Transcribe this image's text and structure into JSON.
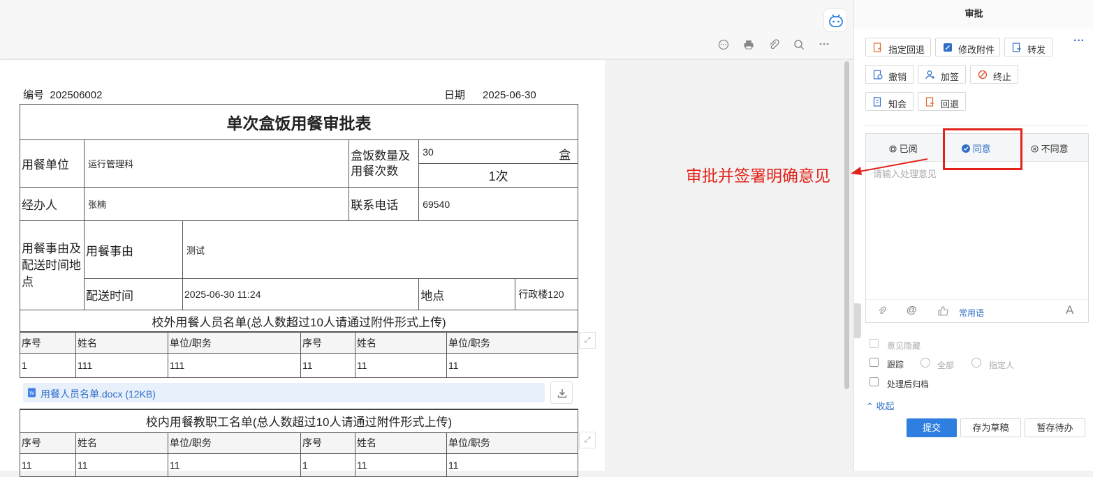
{
  "toolbar": {
    "icons": [
      "comment-icon",
      "print-icon",
      "attachment-icon",
      "search-icon",
      "more-icon"
    ],
    "assistant_icon": "robot-icon"
  },
  "form": {
    "serial_label": "编号",
    "serial_value": "202506002",
    "date_label": "日期",
    "date_value": "2025-06-30",
    "title": "单次盒饭用餐审批表",
    "unit_label": "用餐单位",
    "unit_value": "运行管理科",
    "qty_label": "盒饭数量及用餐次数",
    "qty_value": "30",
    "qty_unit": "盒",
    "times_value": "1次",
    "handler_label": "经办人",
    "handler_value": "张楠",
    "phone_label": "联系电话",
    "phone_value": "69540",
    "reason_group_label": "用餐事由及配送时间地点",
    "reason_label": "用餐事由",
    "reason_value": "测试",
    "delivery_time_label": "配送时间",
    "delivery_time_value": "2025-06-30 11:24",
    "place_label": "地点",
    "place_value": "行政楼120"
  },
  "external_list": {
    "title": "校外用餐人员名单(总人数超过10人请通过附件形式上传)",
    "headers": [
      "序号",
      "姓名",
      "单位/职务",
      "序号",
      "姓名",
      "单位/职务"
    ],
    "rows": [
      [
        "1",
        "111",
        "111",
        "11",
        "11",
        "11"
      ]
    ],
    "attachment": "用餐人员名单.docx (12KB)"
  },
  "internal_list": {
    "title": "校内用餐教职工名单(总人数超过10人请通过附件形式上传)",
    "headers": [
      "序号",
      "姓名",
      "单位/职务",
      "序号",
      "姓名",
      "单位/职务"
    ],
    "rows": [
      [
        "11",
        "11",
        "11",
        "1",
        "11",
        "11"
      ]
    ]
  },
  "annotation": "审批并签署明确意见",
  "panel": {
    "title": "审批",
    "actions_row1": [
      "指定回退",
      "修改附件",
      "转发"
    ],
    "actions_row2": [
      "撤销",
      "加签",
      "终止"
    ],
    "actions_row3": [
      "知会",
      "回退"
    ],
    "more": "···",
    "opinion_tabs": [
      "已阅",
      "同意",
      "不同意"
    ],
    "selected_tab": "同意",
    "placeholder": "请输入处理意见",
    "common_phrases": "常用语",
    "hide_opinion": "意见隐藏",
    "track": "跟踪",
    "track_all": "全部",
    "track_specified": "指定人",
    "archive": "处理后归档",
    "collapse": "收起",
    "submit": "提交",
    "save_draft": "存为草稿",
    "hold": "暂存待办",
    "accent": "#2f7fe0",
    "annotation_color": "#e2231a"
  }
}
